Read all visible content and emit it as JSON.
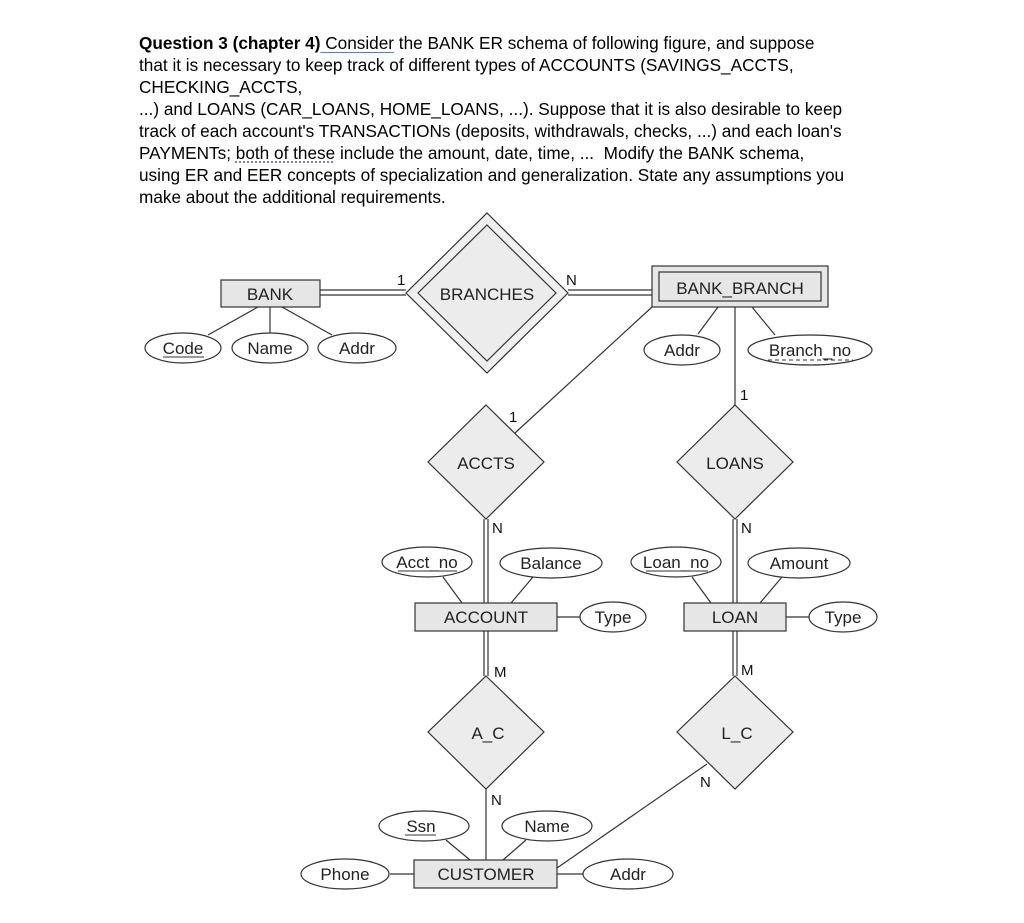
{
  "question": {
    "heading": "Question 3 (chapter 4)",
    "lines": [
      " Consider",
      " the BANK ER schema of following figure, and suppose",
      "that it is necessary to keep track of different types of ACCOUNTS (SAVINGS_ACCTS,",
      "CHECKING_ACCTS,",
      "...) and LOANS (CAR_LOANS, HOME_LOANS, ...). Suppose that it is also desirable to keep",
      "track of each account's TRANSACTIONs (deposits, withdrawals, checks, ...) and each loan's",
      "PAYMENTs; ",
      "both of these",
      " include the amount, date, time, ...  Modify the BANK schema,",
      "using ER and EER concepts of specialization and generalization. State any assumptions you",
      "make about the additional requirements."
    ]
  },
  "diagram": {
    "entities": {
      "bank": "BANK",
      "bank_branch": "BANK_BRANCH",
      "account": "ACCOUNT",
      "loan": "LOAN",
      "customer": "CUSTOMER"
    },
    "relationships": {
      "branches": "BRANCHES",
      "accts": "ACCTS",
      "loans": "LOANS",
      "a_c": "A_C",
      "l_c": "L_C"
    },
    "attributes": {
      "bank_code": "Code",
      "bank_name": "Name",
      "bank_addr": "Addr",
      "branch_addr": "Addr",
      "branch_no": "Branch_no",
      "acct_no": "Acct_no",
      "balance": "Balance",
      "account_type": "Type",
      "loan_no": "Loan_no",
      "amount": "Amount",
      "loan_type": "Type",
      "ssn": "Ssn",
      "customer_name": "Name",
      "phone": "Phone",
      "customer_addr": "Addr"
    },
    "cardinalities": {
      "branches_bank": "1",
      "branches_branch": "N",
      "accts_branch": "1",
      "accts_account": "N",
      "loans_branch": "1",
      "loans_loan": "N",
      "ac_account": "M",
      "ac_customer": "N",
      "lc_loan": "M",
      "lc_customer": "N"
    },
    "colors": {
      "fill": "#e6e6e6",
      "diamond_fill": "#f0f0f0",
      "stroke": "#333333"
    }
  }
}
